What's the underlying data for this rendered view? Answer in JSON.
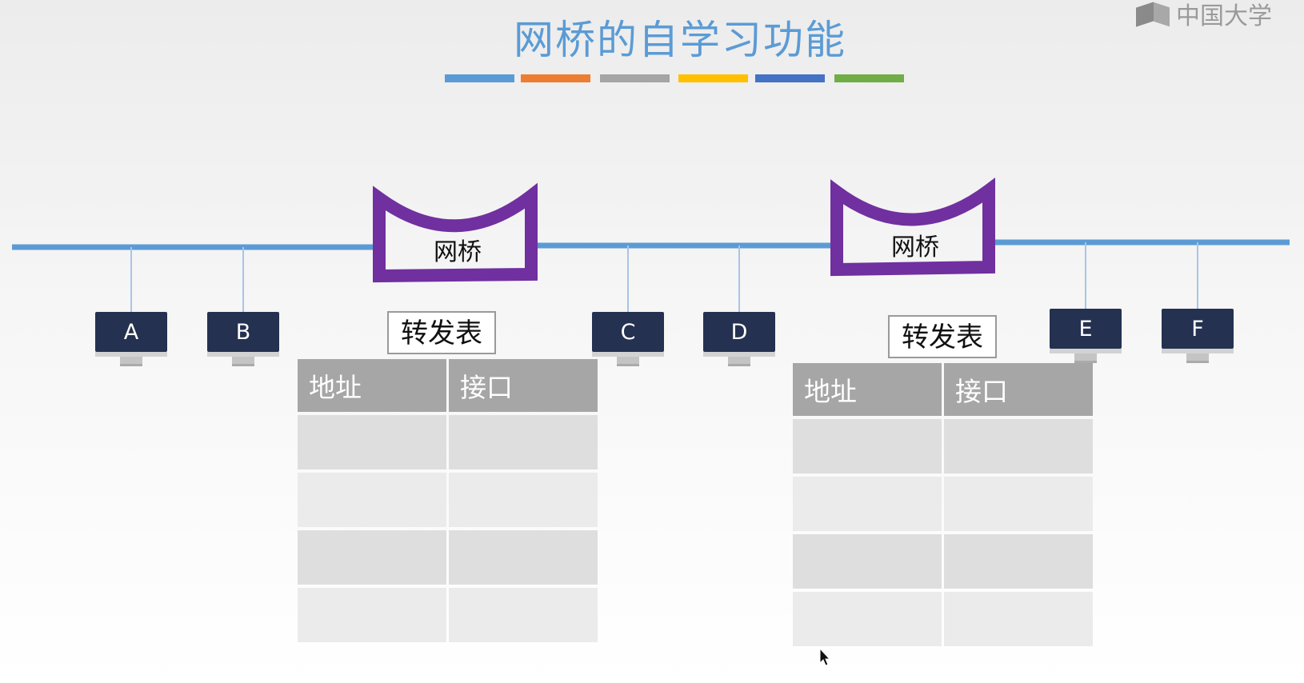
{
  "title": "网桥的自学习功能",
  "watermark": "中国大学",
  "palette": [
    "#5b9bd5",
    "#ed7d31",
    "#a5a5a5",
    "#ffc000",
    "#4472c4",
    "#70ad47"
  ],
  "bridge_label": "网桥",
  "hosts": [
    "A",
    "B",
    "C",
    "D",
    "E",
    "F"
  ],
  "tables": [
    {
      "caption": "转发表",
      "headers": [
        "地址",
        "接口"
      ],
      "rows": [
        [
          "",
          ""
        ],
        [
          "",
          ""
        ],
        [
          "",
          ""
        ],
        [
          "",
          ""
        ]
      ]
    },
    {
      "caption": "转发表",
      "headers": [
        "地址",
        "接口"
      ],
      "rows": [
        [
          "",
          ""
        ],
        [
          "",
          ""
        ],
        [
          "",
          ""
        ],
        [
          "",
          ""
        ]
      ]
    }
  ],
  "colors": {
    "line": "#5b9bd5",
    "bridge": "#7030a0",
    "host": "#243150"
  }
}
